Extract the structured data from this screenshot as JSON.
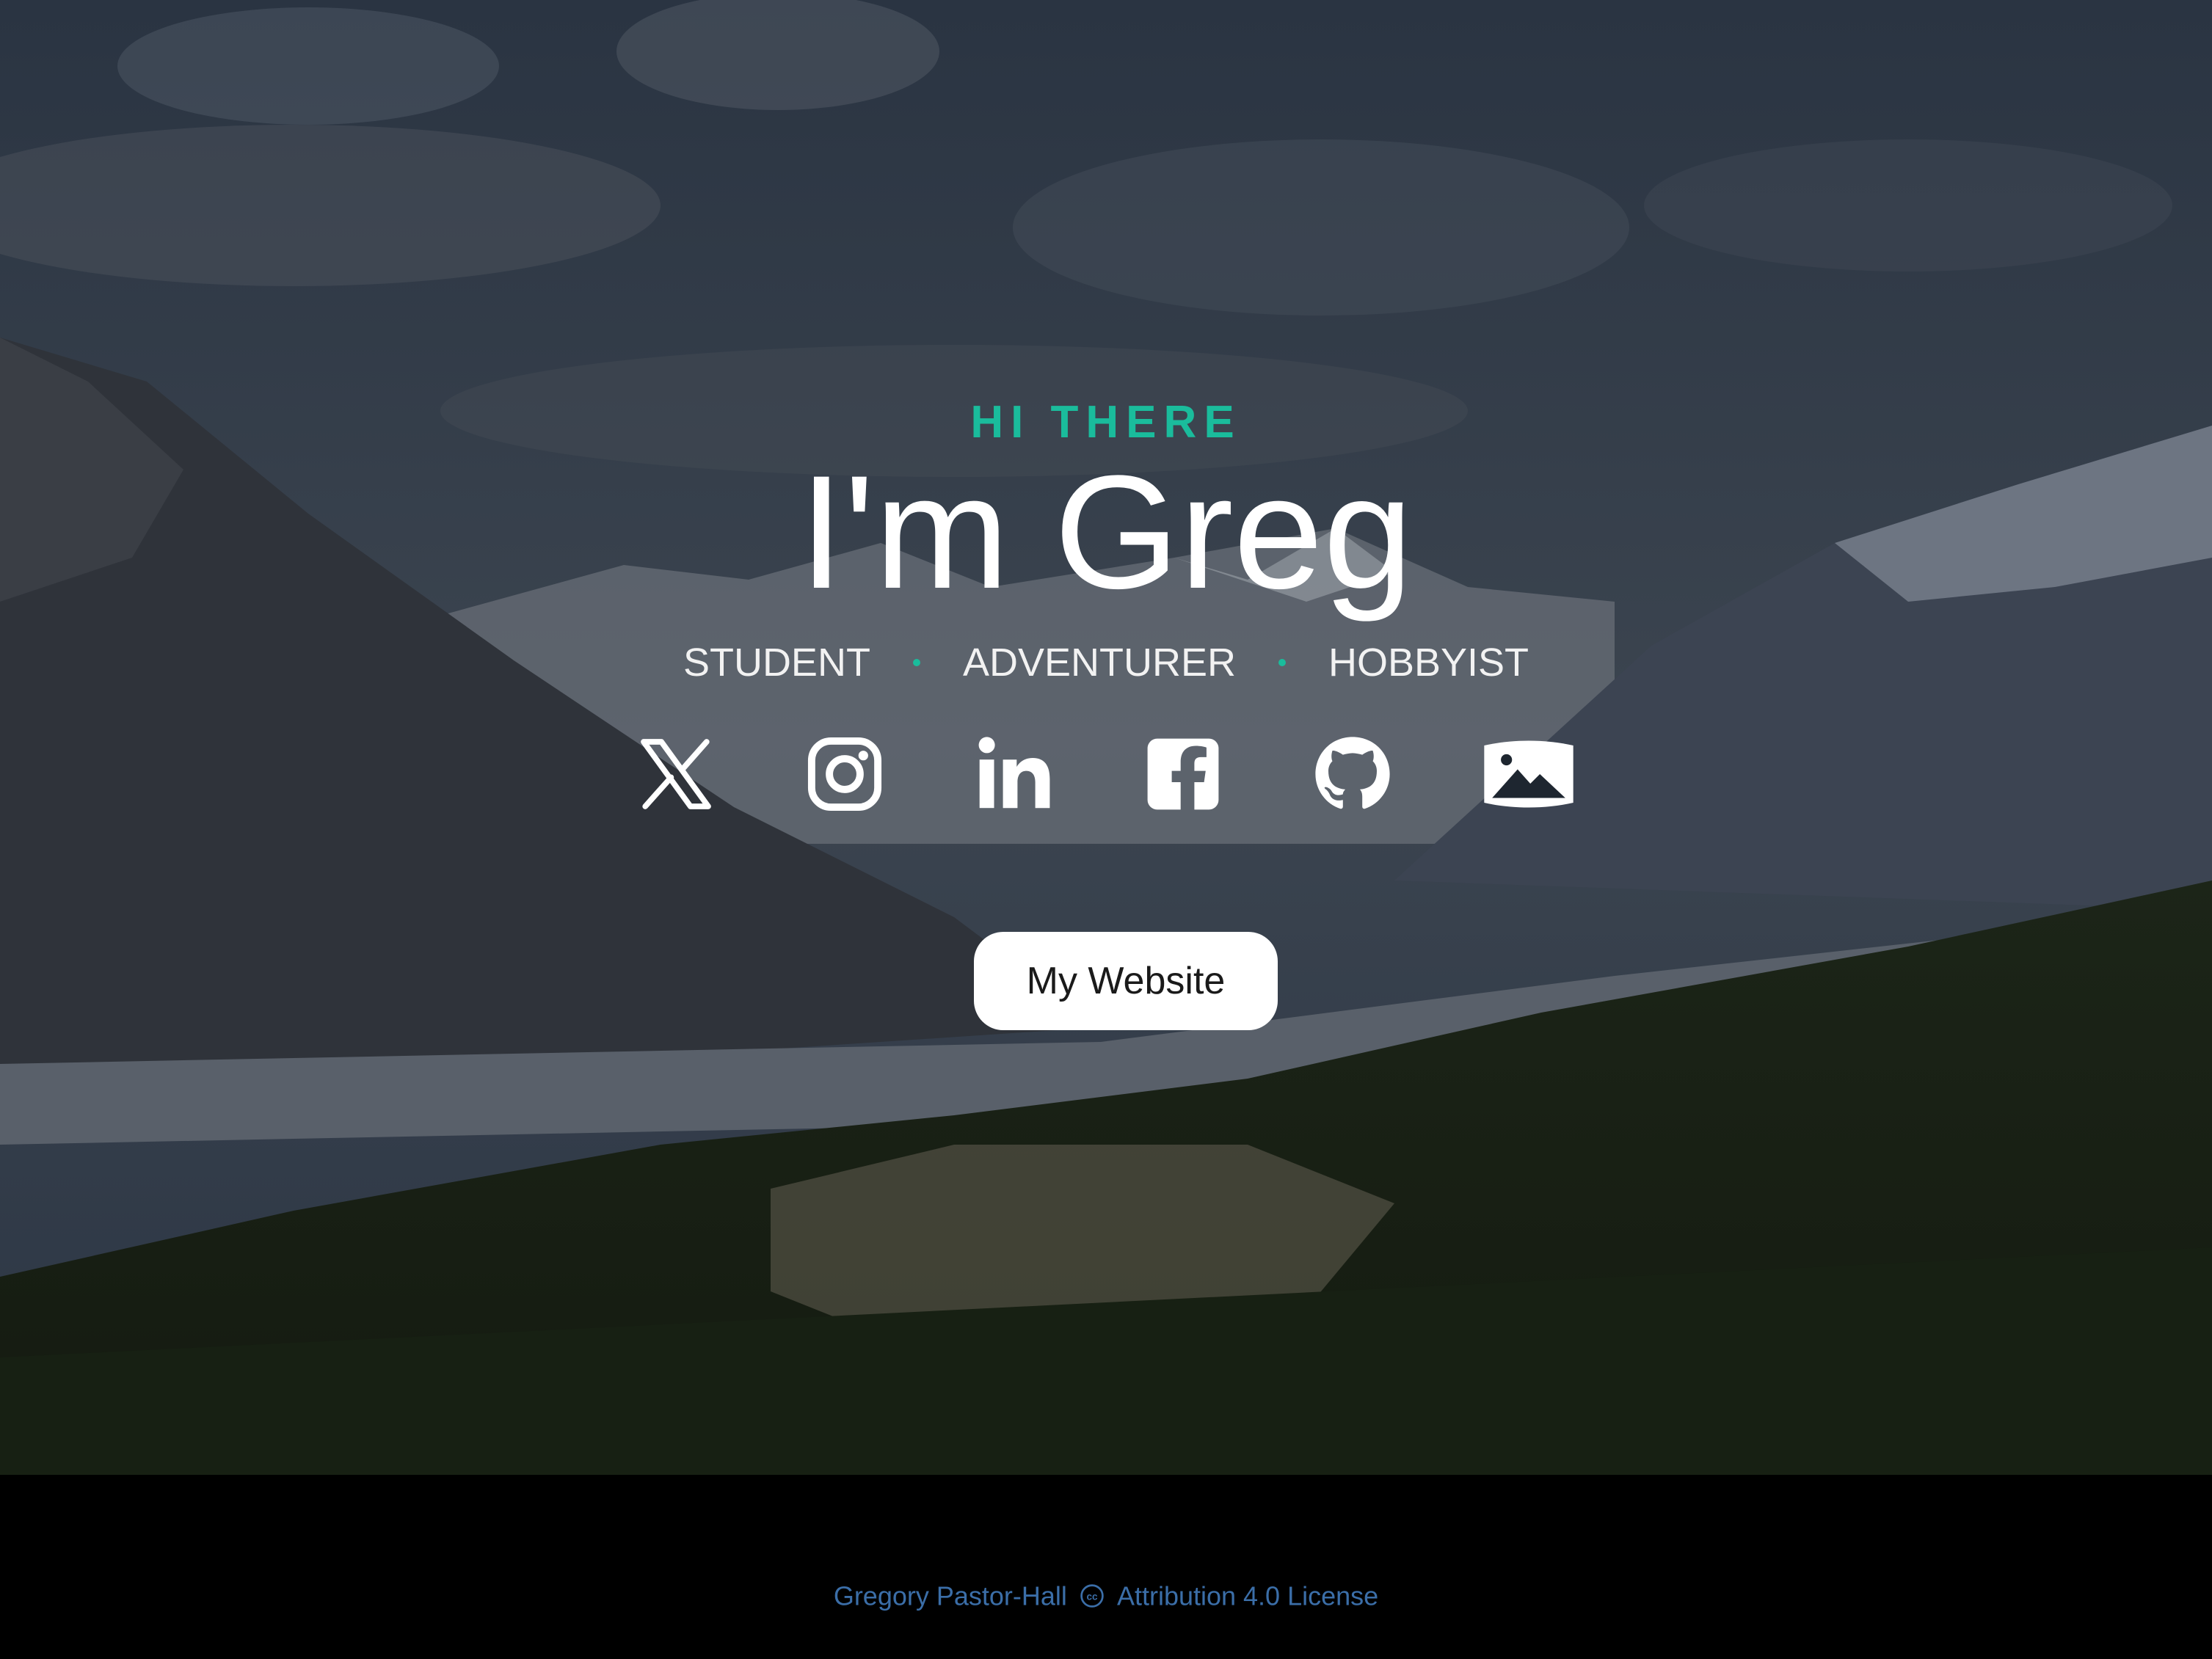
{
  "hero": {
    "eyebrow": "HI THERE",
    "title": "I'm Greg",
    "roles": [
      "STUDENT",
      "ADVENTURER",
      "HOBBYIST"
    ],
    "accent_color": "#1abc9c",
    "background": "mountain-valley-photo",
    "socials": [
      {
        "icon": "x-twitter-icon"
      },
      {
        "icon": "instagram-icon"
      },
      {
        "icon": "linkedin-icon"
      },
      {
        "icon": "facebook-icon"
      },
      {
        "icon": "github-icon"
      },
      {
        "icon": "photo-gallery-icon"
      }
    ],
    "cta_label": "My Website"
  },
  "footer": {
    "author": "Gregory Pastor-Hall",
    "license": "Attribution 4.0 License",
    "license_icon": "creative-commons-icon",
    "text_color": "#3b6ea8"
  }
}
